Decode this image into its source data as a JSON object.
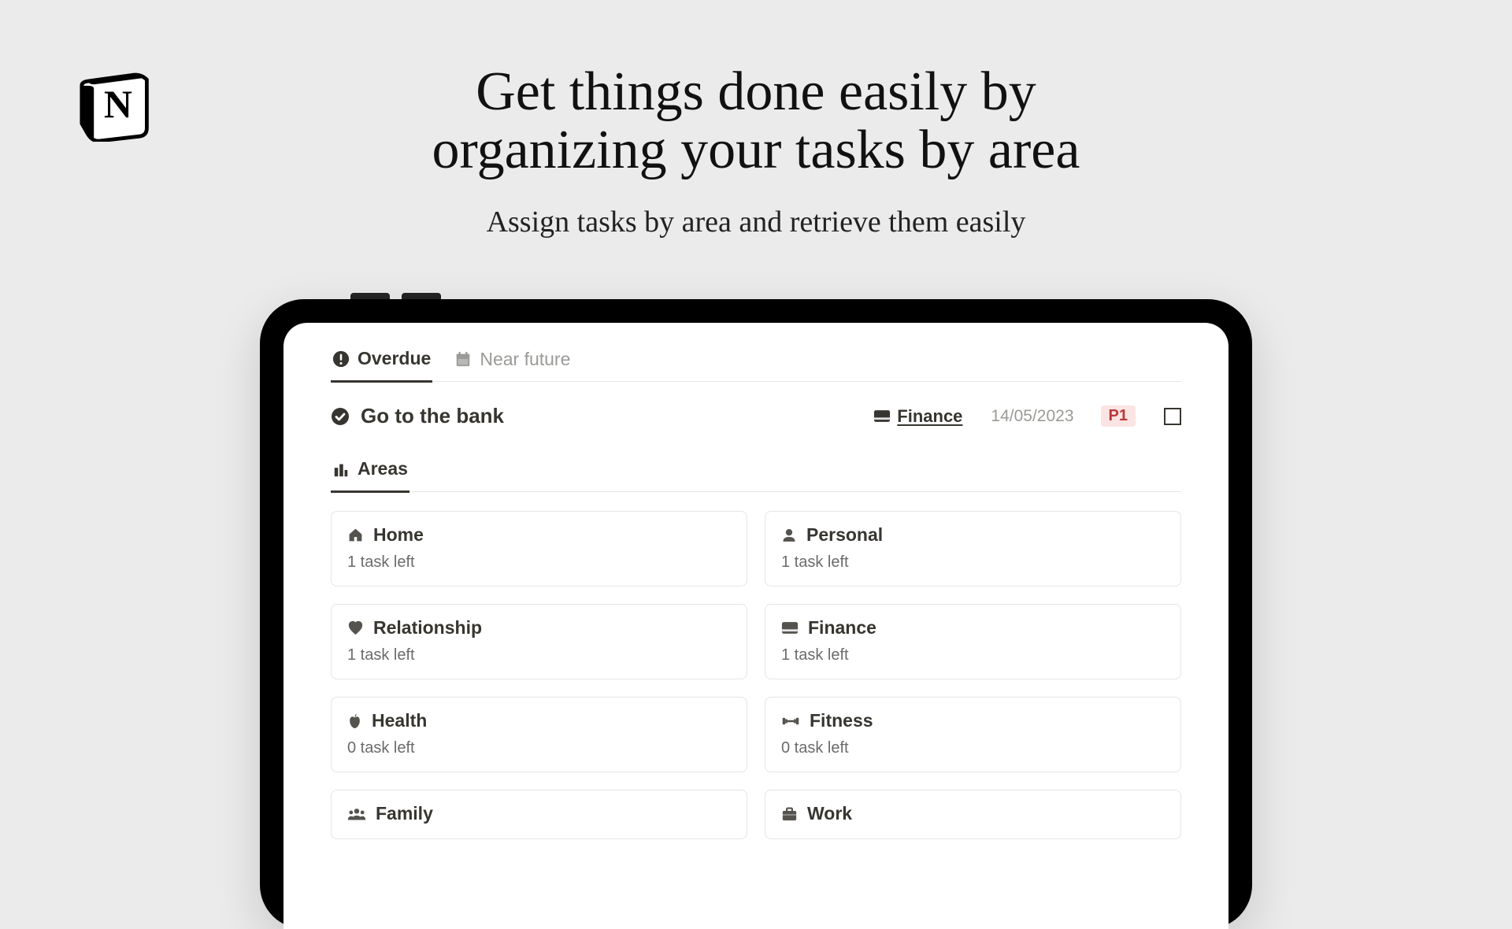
{
  "heading": "Get things done easily by\norganizing your tasks by area",
  "subheading": "Assign tasks by area and retrieve them easily",
  "tabs": [
    {
      "label": "Overdue",
      "icon": "alert-circle"
    },
    {
      "label": "Near future",
      "icon": "calendar"
    }
  ],
  "task": {
    "title": "Go to the bank",
    "area": "Finance",
    "date": "14/05/2023",
    "priority": "P1"
  },
  "section": {
    "label": "Areas",
    "icon": "city"
  },
  "cards": [
    {
      "icon": "home",
      "title": "Home",
      "sub": "1 task left"
    },
    {
      "icon": "user",
      "title": "Personal",
      "sub": "1 task left"
    },
    {
      "icon": "heart",
      "title": "Relationship",
      "sub": "1 task left"
    },
    {
      "icon": "card",
      "title": "Finance",
      "sub": "1 task left"
    },
    {
      "icon": "apple",
      "title": "Health",
      "sub": "0 task left"
    },
    {
      "icon": "dumbbell",
      "title": "Fitness",
      "sub": "0 task left"
    },
    {
      "icon": "group",
      "title": "Family",
      "sub": ""
    },
    {
      "icon": "briefcase",
      "title": "Work",
      "sub": ""
    }
  ]
}
